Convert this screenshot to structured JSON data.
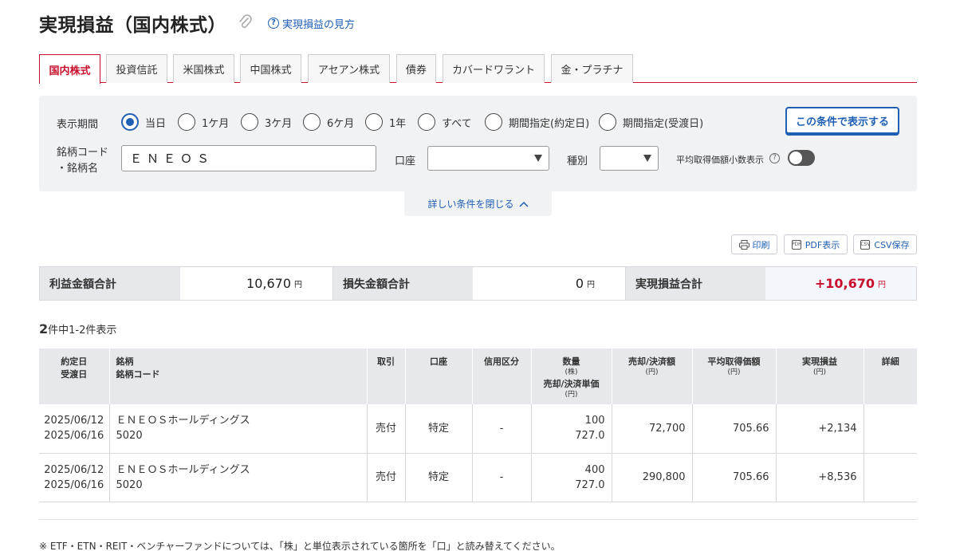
{
  "page": {
    "title": "実現損益（国内株式）",
    "help_link": "実現損益の見方"
  },
  "tabs": [
    {
      "label": "国内株式",
      "active": true
    },
    {
      "label": "投資信託"
    },
    {
      "label": "米国株式"
    },
    {
      "label": "中国株式"
    },
    {
      "label": "アセアン株式"
    },
    {
      "label": "債券"
    },
    {
      "label": "カバードワラント"
    },
    {
      "label": "金・プラチナ"
    }
  ],
  "filter": {
    "period_label": "表示期間",
    "period_options": [
      "当日",
      "1ケ月",
      "3ケ月",
      "6ケ月",
      "1年",
      "すべて",
      "期間指定(約定日)",
      "期間指定(受渡日)"
    ],
    "period_selected": "当日",
    "search_button": "この条件で表示する",
    "code_label_1": "銘柄コード",
    "code_label_2": "・銘柄名",
    "code_value": "ＥＮＥＯＳ",
    "account_label": "口座",
    "account_value": "",
    "type_label": "種別",
    "type_value": "",
    "decimal_label": "平均取得価額小数表示",
    "decimal_on": false,
    "collapse_label": "詳しい条件を閉じる"
  },
  "tools": {
    "print": "印刷",
    "pdf": "PDF表示",
    "csv": "CSV保存"
  },
  "summary": {
    "profit_label": "利益金額合計",
    "profit_value": "10,670",
    "loss_label": "損失金額合計",
    "loss_value": "0",
    "total_label": "実現損益合計",
    "total_value": "+10,670",
    "unit": "円"
  },
  "count": {
    "total": "2",
    "text": "件中1-2件表示"
  },
  "table": {
    "headers": {
      "date_1": "約定日",
      "date_2": "受渡日",
      "name_1": "銘柄",
      "name_2": "銘柄コード",
      "trade": "取引",
      "account": "口座",
      "credit": "信用区分",
      "qty": "数量",
      "qty_unit": "(株)",
      "unit_price": "売却/決済単価",
      "unit_price_unit": "(円)",
      "amount": "売却/決済額",
      "amount_unit": "(円)",
      "avg": "平均取得価額",
      "avg_unit": "(円)",
      "pl": "実現損益",
      "pl_unit": "(円)",
      "detail": "詳細"
    },
    "rows": [
      {
        "trade_date": "2025/06/12",
        "settle_date": "2025/06/16",
        "name": "ＥＮＥＯＳホールディングス",
        "code": "5020",
        "trade": "売付",
        "account": "特定",
        "credit": "-",
        "qty": "100",
        "price": "727.0",
        "amount": "72,700",
        "avg": "705.66",
        "pl": "+2,134"
      },
      {
        "trade_date": "2025/06/12",
        "settle_date": "2025/06/16",
        "name": "ＥＮＥＯＳホールディングス",
        "code": "5020",
        "trade": "売付",
        "account": "特定",
        "credit": "-",
        "qty": "400",
        "price": "727.0",
        "amount": "290,800",
        "avg": "705.66",
        "pl": "+8,536"
      }
    ]
  },
  "note": "※ ETF・ETN・REIT・ベンチャーファンドについては、「株」と単位表示されている箇所を「口」と読み替えてください。",
  "colors": {
    "accent_red": "#c8102e",
    "link_blue": "#1f5fb4"
  }
}
